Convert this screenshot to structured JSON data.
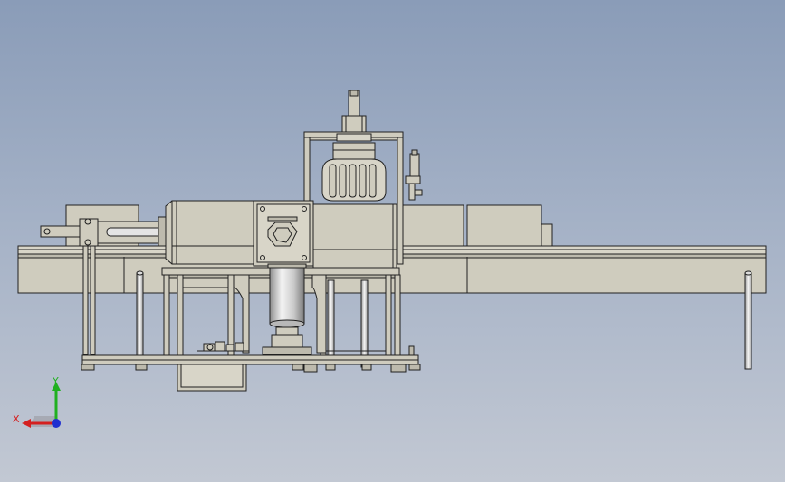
{
  "viewport": {
    "background_top": "#8a9cb8",
    "background_bottom": "#c2c8d3",
    "model_color": "#cfccbe",
    "outline_color": "#202020"
  },
  "triad": {
    "x_label": "X",
    "y_label": "Y",
    "x_color": "#d42020",
    "y_color": "#20b020",
    "z_color": "#2030d0"
  }
}
